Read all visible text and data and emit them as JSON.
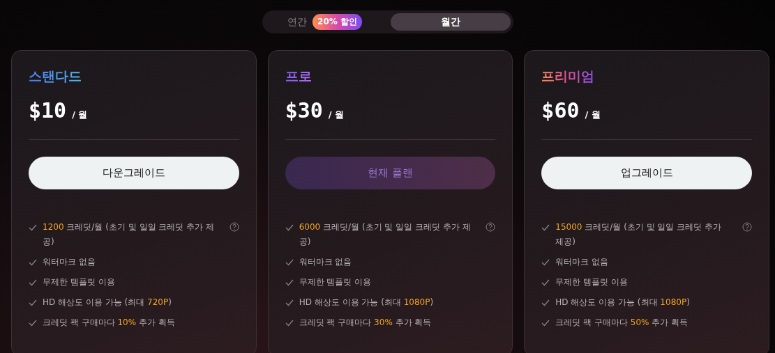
{
  "billing_toggle": {
    "options": [
      {
        "label": "연간",
        "badge": "20% 할인",
        "selected": false
      },
      {
        "label": "월간",
        "selected": true
      }
    ]
  },
  "plans": [
    {
      "name": "스탠다드",
      "kind": "standard",
      "price": "$10",
      "period": "/ 월",
      "button": {
        "label": "다운그레이드",
        "current": false
      },
      "features": [
        {
          "parts": [
            {
              "text": "1200",
              "accent": true
            },
            {
              "text": " 크레딧/월 (초기 및 일일 크레딧 추가 제공)",
              "accent": false
            }
          ],
          "help": true
        },
        {
          "parts": [
            {
              "text": "워터마크 없음",
              "accent": false
            }
          ],
          "help": false
        },
        {
          "parts": [
            {
              "text": "무제한 템플릿 이용",
              "accent": false
            }
          ],
          "help": false
        },
        {
          "parts": [
            {
              "text": "HD 해상도 이용 가능 (최대 ",
              "accent": false
            },
            {
              "text": "720P",
              "accent": true
            },
            {
              "text": ")",
              "accent": false
            }
          ],
          "help": false
        },
        {
          "parts": [
            {
              "text": "크레딧 팩 구매마다 ",
              "accent": false
            },
            {
              "text": "10%",
              "accent": true
            },
            {
              "text": " 추가 획득",
              "accent": false
            }
          ],
          "help": false
        }
      ]
    },
    {
      "name": "프로",
      "kind": "pro",
      "price": "$30",
      "period": "/ 월",
      "button": {
        "label": "현재 플랜",
        "current": true
      },
      "features": [
        {
          "parts": [
            {
              "text": "6000",
              "accent": true
            },
            {
              "text": " 크레딧/월 (초기 및 일일 크레딧 추가 제공)",
              "accent": false
            }
          ],
          "help": true
        },
        {
          "parts": [
            {
              "text": "워터마크 없음",
              "accent": false
            }
          ],
          "help": false
        },
        {
          "parts": [
            {
              "text": "무제한 템플릿 이용",
              "accent": false
            }
          ],
          "help": false
        },
        {
          "parts": [
            {
              "text": "HD 해상도 이용 가능 (최대 ",
              "accent": false
            },
            {
              "text": "1080P",
              "accent": true
            },
            {
              "text": ")",
              "accent": false
            }
          ],
          "help": false
        },
        {
          "parts": [
            {
              "text": "크레딧 팩 구매마다 ",
              "accent": false
            },
            {
              "text": "30%",
              "accent": true
            },
            {
              "text": " 추가 획득",
              "accent": false
            }
          ],
          "help": false
        }
      ]
    },
    {
      "name": "프리미엄",
      "kind": "premium",
      "price": "$60",
      "period": "/ 월",
      "button": {
        "label": "업그레이드",
        "current": false
      },
      "features": [
        {
          "parts": [
            {
              "text": "15000",
              "accent": true
            },
            {
              "text": " 크레딧/월 (초기 및 일일 크레딧 추가 제공)",
              "accent": false
            }
          ],
          "help": true
        },
        {
          "parts": [
            {
              "text": "워터마크 없음",
              "accent": false
            }
          ],
          "help": false
        },
        {
          "parts": [
            {
              "text": "무제한 템플릿 이용",
              "accent": false
            }
          ],
          "help": false
        },
        {
          "parts": [
            {
              "text": "HD 해상도 이용 가능 (최대 ",
              "accent": false
            },
            {
              "text": "1080P",
              "accent": true
            },
            {
              "text": ")",
              "accent": false
            }
          ],
          "help": false
        },
        {
          "parts": [
            {
              "text": "크레딧 팩 구매마다 ",
              "accent": false
            },
            {
              "text": "50%",
              "accent": true
            },
            {
              "text": " 추가 획득",
              "accent": false
            }
          ],
          "help": false
        }
      ]
    }
  ]
}
